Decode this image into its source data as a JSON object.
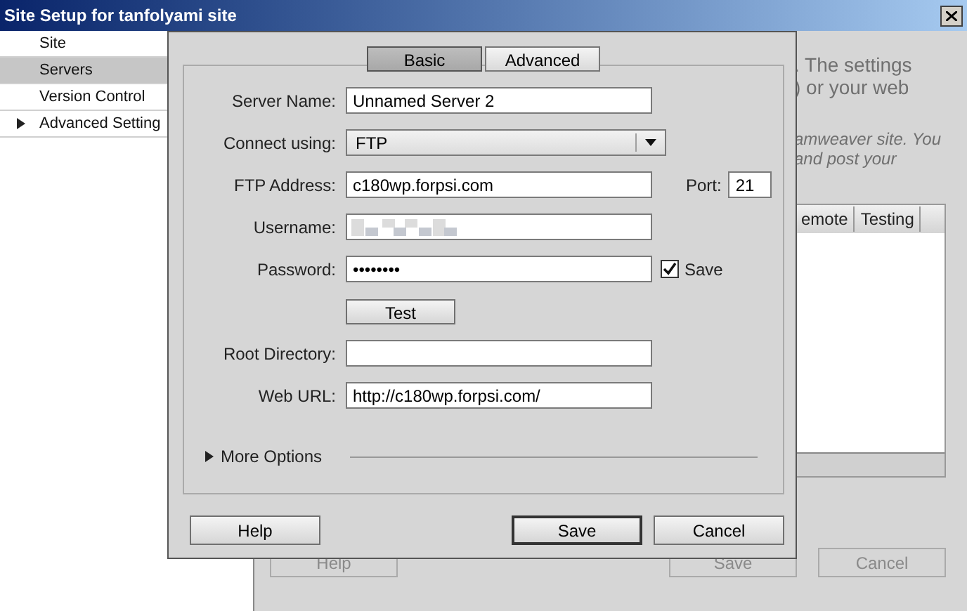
{
  "window": {
    "title": "Site Setup for tanfolyami site"
  },
  "sidebar": {
    "items": [
      {
        "kind": "item",
        "label": "Site",
        "selected": false
      },
      {
        "kind": "item",
        "label": "Servers",
        "selected": true
      },
      {
        "kind": "item",
        "label": "Version Control",
        "selected": false
      },
      {
        "kind": "group",
        "label": "Advanced Setting",
        "selected": false,
        "expanded": false
      }
    ]
  },
  "background": {
    "text_lines": [
      {
        "text": ". The settings",
        "italic": false
      },
      {
        "text": ") or your web",
        "italic": false
      },
      {
        "text": "amweaver site. You",
        "italic": true
      },
      {
        "text": "and post your",
        "italic": true
      }
    ],
    "table": {
      "columns": [
        "emote",
        "Testing"
      ]
    },
    "buttons": [
      {
        "label": "Help",
        "disabled": true
      },
      {
        "label": "Save",
        "disabled": true
      },
      {
        "label": "Cancel",
        "disabled": true
      }
    ]
  },
  "dialog": {
    "tabs": [
      {
        "label": "Basic",
        "selected": true
      },
      {
        "label": "Advanced",
        "selected": false
      }
    ],
    "fields": [
      {
        "kind": "text",
        "label": "Server Name:",
        "value": "Unnamed Server 2"
      },
      {
        "kind": "select",
        "label": "Connect using:",
        "value": "FTP"
      },
      {
        "kind": "text_port",
        "label": "FTP Address:",
        "value": "c180wp.forpsi.com",
        "port_label": "Port:",
        "port": "21"
      },
      {
        "kind": "redacted",
        "label": "Username:"
      },
      {
        "kind": "password",
        "label": "Password:",
        "value": "••••••••",
        "save_label": "Save",
        "save_checked": true
      },
      {
        "kind": "button",
        "label": "Test"
      },
      {
        "kind": "text",
        "label": "Root Directory:"
      },
      {
        "kind": "text",
        "label": "Web URL:",
        "value": "http://c180wp.forpsi.com/"
      }
    ],
    "more_options": {
      "label": "More Options",
      "expanded": false
    },
    "buttons": [
      {
        "label": "Help",
        "default": false
      },
      {
        "label": "Save",
        "default": true
      },
      {
        "label": "Cancel",
        "default": false
      }
    ]
  }
}
